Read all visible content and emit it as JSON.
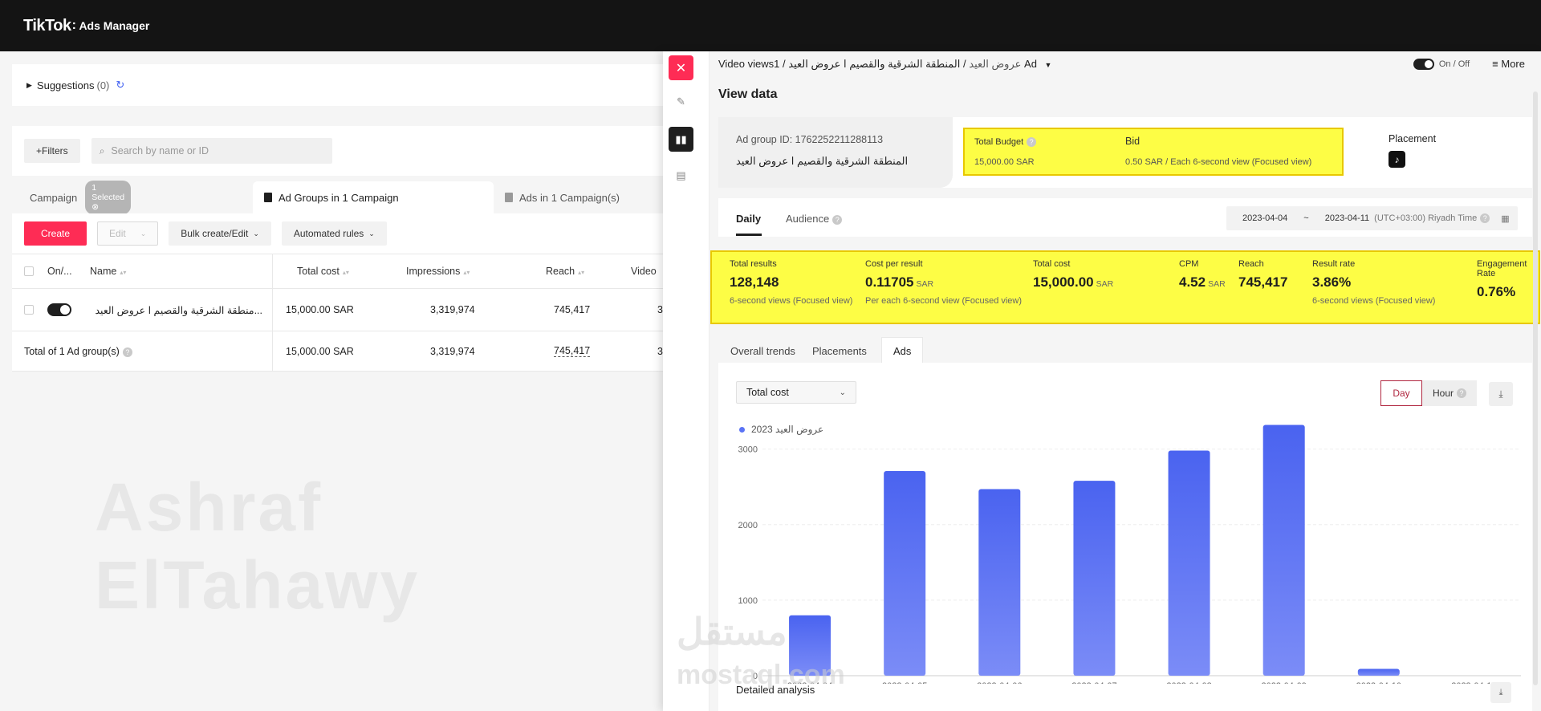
{
  "topbar": {
    "brand": "TikTok",
    "sep": ":",
    "product": "Ads Manager"
  },
  "suggestions": {
    "label": "Suggestions",
    "count": "(0)"
  },
  "filters": {
    "button": "+Filters",
    "search_placeholder": "Search by name or ID"
  },
  "tabs": {
    "campaign": "Campaign",
    "selected_badge": "1 Selected",
    "ad_groups": "Ad Groups in 1 Campaign",
    "ads": "Ads in 1 Campaign(s)"
  },
  "toolbar": {
    "create": "Create",
    "edit": "Edit",
    "bulk": "Bulk create/Edit",
    "rules": "Automated rules"
  },
  "table": {
    "headers": {
      "onoff": "On/...",
      "name": "Name",
      "total_cost": "Total cost",
      "impressions": "Impressions",
      "reach": "Reach",
      "video": "Video"
    },
    "row": {
      "name": "...منطقة الشرقية والقصيم ا عروض العيد",
      "total_cost": "15,000.00 SAR",
      "impressions": "3,319,974",
      "reach": "745,417",
      "video": "3"
    },
    "total": {
      "label": "Total of 1 Ad group(s)",
      "total_cost": "15,000.00 SAR",
      "impressions": "3,319,974",
      "reach": "745,417",
      "video": "3"
    }
  },
  "watermark": "Ashraf ElTahawy",
  "panel": {
    "breadcrumb": {
      "part1": "Video views",
      "part2": "عروض العيد",
      "sep": "/",
      "part3": "المنطقة الشرقية والقصيم ا عروض العيد",
      "part4": "1 Ad"
    },
    "onoff": "On / Off",
    "more": "More",
    "title": "View data",
    "ad_group_id": "Ad group ID: 1762252211288113",
    "ad_group_name": "المنطقة الشرقية والقصيم ا عروض العيد",
    "budget": {
      "label": "Total Budget",
      "value": "15,000.00 SAR",
      "bid_label": "Bid",
      "bid_value": "0.50 SAR / Each 6-second view (Focused view)"
    },
    "placement": "Placement",
    "data_tabs": {
      "daily": "Daily",
      "audience": "Audience"
    },
    "date": {
      "start": "2023-04-04",
      "tilde": "~",
      "end": "2023-04-11",
      "tz": "(UTC+03:00) Riyadh Time"
    },
    "metrics": [
      {
        "label": "Total results",
        "value": "128,148",
        "unit": "",
        "sub": "6-second views (Focused view)"
      },
      {
        "label": "Cost per result",
        "value": "0.11705",
        "unit": "SAR",
        "sub": "Per each 6-second view (Focused view)"
      },
      {
        "label": "Total cost",
        "value": "15,000.00",
        "unit": "SAR",
        "sub": ""
      },
      {
        "label": "CPM",
        "value": "4.52",
        "unit": "SAR",
        "sub": ""
      },
      {
        "label": "Reach",
        "value": "745,417",
        "unit": "",
        "sub": ""
      },
      {
        "label": "Result rate",
        "value": "3.86%",
        "unit": "",
        "sub": "6-second views (Focused view)"
      },
      {
        "label": "Engagement Rate",
        "value": "0.76%",
        "unit": "",
        "sub": ""
      }
    ],
    "chart_tabs": {
      "overall": "Overall trends",
      "placements": "Placements",
      "ads": "Ads"
    },
    "metric_select": "Total cost",
    "granularity": {
      "day": "Day",
      "hour": "Hour"
    },
    "detailed": "Detailed analysis"
  },
  "chart_data": {
    "type": "bar",
    "categories": [
      "2023-04-04",
      "2023-04-05",
      "2023-04-06",
      "2023-04-07",
      "2023-04-08",
      "2023-04-09",
      "2023-04-10",
      "2023-04-11"
    ],
    "series": [
      {
        "name": "عروض العيد 2023",
        "values": [
          800,
          2710,
          2470,
          2580,
          2980,
          3320,
          90,
          0
        ]
      }
    ],
    "ylim": [
      0,
      3400
    ],
    "yticks": [
      0,
      1000,
      2000,
      3000
    ],
    "color": "#4a63f0"
  },
  "mostaql": {
    "ar": "مستقل",
    "en": "mostaql.com"
  }
}
